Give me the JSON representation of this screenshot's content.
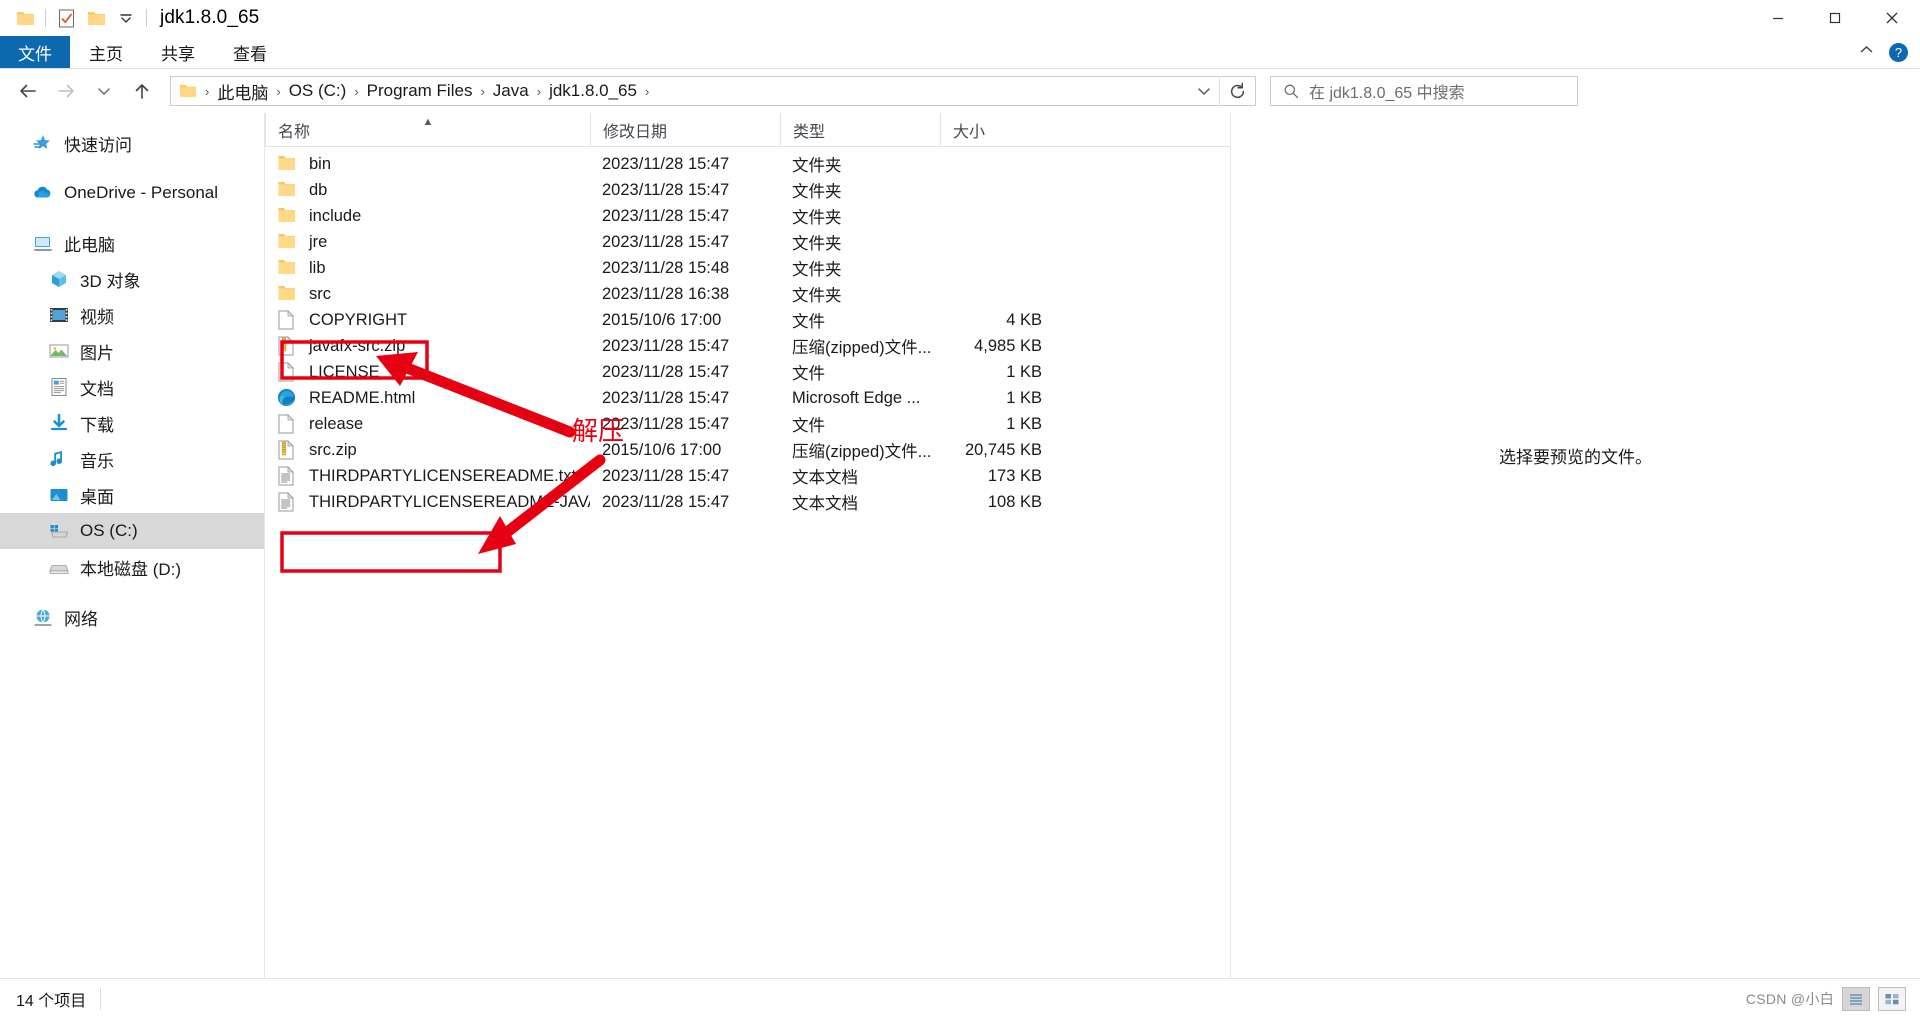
{
  "window": {
    "title": "jdk1.8.0_65",
    "quick_access_icons": [
      "folder-icon",
      "properties-checkmark-icon",
      "new-folder-icon",
      "customize-dropdown-icon"
    ],
    "controls": {
      "minimize": "minimize-icon",
      "maximize": "maximize-icon",
      "close": "close-icon"
    }
  },
  "ribbon": {
    "tabs": [
      {
        "label": "文件",
        "active": true
      },
      {
        "label": "主页",
        "active": false
      },
      {
        "label": "共享",
        "active": false
      },
      {
        "label": "查看",
        "active": false
      }
    ],
    "collapse_label": "chevron-up-icon",
    "help_label": "?"
  },
  "nav": {
    "back": "back-arrow-icon",
    "forward": "forward-arrow-icon",
    "recent": "recent-locations-icon",
    "up": "up-arrow-icon",
    "breadcrumb": [
      "此电脑",
      "OS (C:)",
      "Program Files",
      "Java",
      "jdk1.8.0_65"
    ],
    "breadcrumb_separator": "›",
    "address_dropdown": "chevron-down-icon",
    "refresh": "refresh-icon"
  },
  "search": {
    "placeholder": "在 jdk1.8.0_65 中搜索",
    "icon": "search-icon"
  },
  "sidebar": {
    "items": [
      {
        "label": "快速访问",
        "icon": "quick-access-star-icon",
        "indent": false,
        "selected": false
      },
      {
        "label": "OneDrive - Personal",
        "icon": "onedrive-cloud-icon",
        "indent": false,
        "selected": false
      },
      {
        "label": "此电脑",
        "icon": "this-pc-icon",
        "indent": false,
        "selected": false
      },
      {
        "label": "3D 对象",
        "icon": "3d-objects-icon",
        "indent": true,
        "selected": false
      },
      {
        "label": "视频",
        "icon": "videos-icon",
        "indent": true,
        "selected": false
      },
      {
        "label": "图片",
        "icon": "pictures-icon",
        "indent": true,
        "selected": false
      },
      {
        "label": "文档",
        "icon": "documents-icon",
        "indent": true,
        "selected": false
      },
      {
        "label": "下载",
        "icon": "downloads-icon",
        "indent": true,
        "selected": false
      },
      {
        "label": "音乐",
        "icon": "music-icon",
        "indent": true,
        "selected": false
      },
      {
        "label": "桌面",
        "icon": "desktop-icon",
        "indent": true,
        "selected": false
      },
      {
        "label": "OS (C:)",
        "icon": "windows-drive-icon",
        "indent": true,
        "selected": true
      },
      {
        "label": "本地磁盘 (D:)",
        "icon": "local-drive-icon",
        "indent": true,
        "selected": false
      },
      {
        "label": "网络",
        "icon": "network-icon",
        "indent": false,
        "selected": false
      }
    ]
  },
  "filelist": {
    "columns": [
      {
        "label": "名称",
        "key": "name",
        "sorted": "asc"
      },
      {
        "label": "修改日期",
        "key": "date",
        "sorted": null
      },
      {
        "label": "类型",
        "key": "type",
        "sorted": null
      },
      {
        "label": "大小",
        "key": "size",
        "sorted": null
      }
    ],
    "rows": [
      {
        "name": "bin",
        "date": "2023/11/28 15:47",
        "type": "文件夹",
        "size": "",
        "icon": "folder-icon"
      },
      {
        "name": "db",
        "date": "2023/11/28 15:47",
        "type": "文件夹",
        "size": "",
        "icon": "folder-icon"
      },
      {
        "name": "include",
        "date": "2023/11/28 15:47",
        "type": "文件夹",
        "size": "",
        "icon": "folder-icon"
      },
      {
        "name": "jre",
        "date": "2023/11/28 15:47",
        "type": "文件夹",
        "size": "",
        "icon": "folder-icon"
      },
      {
        "name": "lib",
        "date": "2023/11/28 15:48",
        "type": "文件夹",
        "size": "",
        "icon": "folder-icon"
      },
      {
        "name": "src",
        "date": "2023/11/28 16:38",
        "type": "文件夹",
        "size": "",
        "icon": "folder-icon"
      },
      {
        "name": "COPYRIGHT",
        "date": "2015/10/6 17:00",
        "type": "文件",
        "size": "4 KB",
        "icon": "generic-file-icon"
      },
      {
        "name": "javafx-src.zip",
        "date": "2023/11/28 15:47",
        "type": "压缩(zipped)文件...",
        "size": "4,985 KB",
        "icon": "zip-file-icon"
      },
      {
        "name": "LICENSE",
        "date": "2023/11/28 15:47",
        "type": "文件",
        "size": "1 KB",
        "icon": "generic-file-icon"
      },
      {
        "name": "README.html",
        "date": "2023/11/28 15:47",
        "type": "Microsoft Edge ...",
        "size": "1 KB",
        "icon": "edge-browser-icon"
      },
      {
        "name": "release",
        "date": "2023/11/28 15:47",
        "type": "文件",
        "size": "1 KB",
        "icon": "generic-file-icon"
      },
      {
        "name": "src.zip",
        "date": "2015/10/6 17:00",
        "type": "压缩(zipped)文件...",
        "size": "20,745 KB",
        "icon": "zip-file-icon"
      },
      {
        "name": "THIRDPARTYLICENSEREADME.txt",
        "date": "2023/11/28 15:47",
        "type": "文本文档",
        "size": "173 KB",
        "icon": "text-file-icon"
      },
      {
        "name": "THIRDPARTYLICENSEREADME-JAVAF...",
        "date": "2023/11/28 15:47",
        "type": "文本文档",
        "size": "108 KB",
        "icon": "text-file-icon"
      }
    ]
  },
  "preview": {
    "empty_text": "选择要预览的文件。"
  },
  "statusbar": {
    "item_count": "14 个项目",
    "watermark": "CSDN @小白",
    "view_details_icon": "details-view-icon",
    "view_large_icons_icon": "large-icons-view-icon"
  },
  "annotations": {
    "label": "解压",
    "color": "#e60012",
    "highlight_rows": [
      "src",
      "src.zip"
    ]
  },
  "colors": {
    "accent": "#0c69b0",
    "selection": "#d8d8d8",
    "annotation_red": "#e60012",
    "folder_yellow": "#ffd073"
  }
}
